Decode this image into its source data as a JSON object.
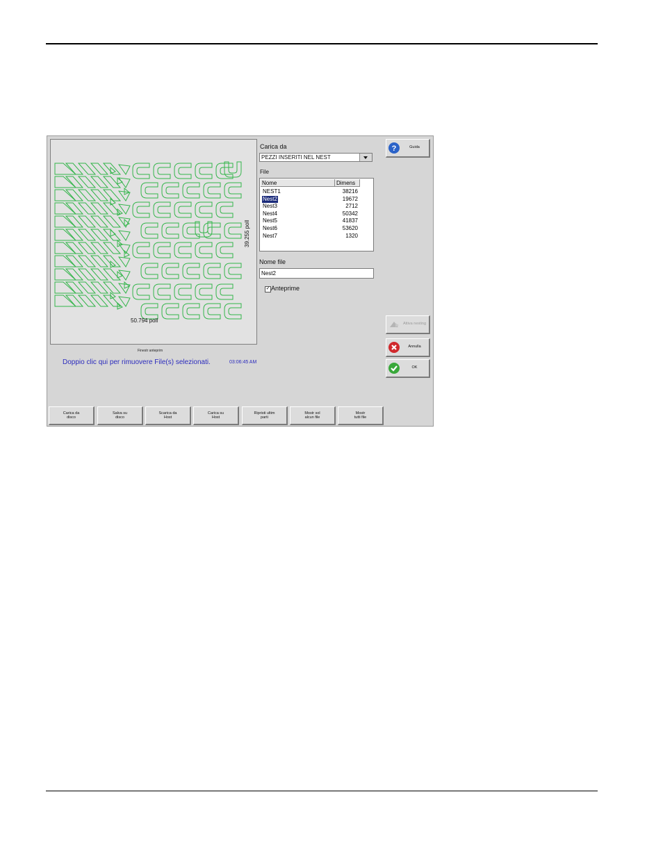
{
  "preview": {
    "width_label": "50.794 poll",
    "height_label": "39.255 poll",
    "caption": "Finestr anteprim"
  },
  "status": {
    "message": "Doppio clic qui per rimuovere File(s) selezionati.",
    "time": "03:06:45 AM"
  },
  "load_from": {
    "label": "Carica da",
    "value": "PEZZI INSERITI NEL NEST"
  },
  "file_list": {
    "label": "File",
    "columns": [
      "Nome",
      "Dimens"
    ],
    "rows": [
      {
        "name": "NEST1",
        "size": "38216"
      },
      {
        "name": "Nest2",
        "size": "19672",
        "selected": true
      },
      {
        "name": "Nest3",
        "size": "2712"
      },
      {
        "name": "Nest4",
        "size": "50342"
      },
      {
        "name": "Nest5",
        "size": "41837"
      },
      {
        "name": "Nest6",
        "size": "53620"
      },
      {
        "name": "Nest7",
        "size": "1320"
      }
    ]
  },
  "file_name": {
    "label": "Nome file",
    "value": "Nest2"
  },
  "preview_checkbox": {
    "label": "Anteprime",
    "checked": true
  },
  "side_buttons": {
    "help": "Guida",
    "disabled": "Attiva nesting",
    "cancel": "Annulla",
    "ok": "OK"
  },
  "bottom_buttons": [
    {
      "line1": "Carica da",
      "line2": "disco"
    },
    {
      "line1": "Salva su",
      "line2": "disco"
    },
    {
      "line1": "Scarica da",
      "line2": "Host"
    },
    {
      "line1": "Carica su",
      "line2": "Host"
    },
    {
      "line1": "Ripristi ultim",
      "line2": "parti"
    },
    {
      "line1": "Mostr sol",
      "line2": "alcun file"
    },
    {
      "line1": "Mostr",
      "line2": "tutti file"
    }
  ],
  "colors": {
    "part_outline": "#33b54a",
    "status_text": "#2b2bbd",
    "selection": "#1a2a7a",
    "help_icon": "#2a62c8",
    "cancel_icon": "#d0282c",
    "ok_icon": "#39a83a"
  }
}
